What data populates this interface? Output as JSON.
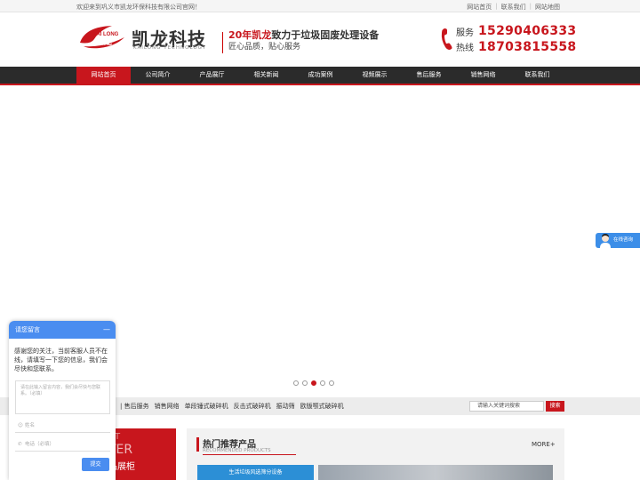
{
  "topbar": {
    "welcome": "欢迎来到巩义市凯龙环保科技有限公司官网！",
    "links": [
      "网站首页",
      "联系我们",
      "网站地图"
    ]
  },
  "header": {
    "logo_cn": "凯龙科技",
    "logo_en": "KAILONG TECHNOLOGY",
    "logo_mark_text": "KAI LONG 凯龙",
    "slogan_red": "20年凯龙",
    "slogan_rest": "致力于垃圾固废处理设备",
    "slogan2": "匠心品质，贴心服务",
    "hotline_labels": [
      "服务",
      "热线"
    ],
    "hotline_numbers": [
      "15290406333",
      "18703815558"
    ]
  },
  "nav": {
    "items": [
      "网站首页",
      "公司简介",
      "产品展厅",
      "相关新闻",
      "成功案例",
      "视频展示",
      "售后服务",
      "销售网络",
      "联系我们"
    ],
    "active_index": 0
  },
  "slider": {
    "dot_count": 5,
    "active_index": 2
  },
  "keywords": {
    "items": [
      "| 售后服务",
      "销售网络",
      "单段锤式破碎机",
      "反击式破碎机",
      "振动筛",
      "欧版颚式破碎机"
    ],
    "search_placeholder": "请输入关键词搜索",
    "search_button": "搜索"
  },
  "product_center": {
    "en1": "CT",
    "en2": "TER",
    "cn": "品展柜"
  },
  "hot_products": {
    "title": "热门推荐产品",
    "subtitle": "RECOMMENDED PRODUCTS",
    "more": "MORE+",
    "first_item": "生活垃圾风选筛分设备"
  },
  "chat": {
    "title": "请您留言",
    "minimize": "—",
    "message": "感谢您的关注，当前客服人员不在线，请填写一下您的信息，我们会尽快和您联系。",
    "textarea_placeholder": "请在此输入留言内容，我们会尽快与您联系。（必填）",
    "name_placeholder": "姓名",
    "phone_placeholder": "电话（必填）",
    "submit": "提交"
  },
  "consult": {
    "label": "在线咨询"
  },
  "colors": {
    "brand_red": "#c8161d",
    "nav_dark": "#2b2b2b",
    "chat_blue": "#4a8df0"
  }
}
